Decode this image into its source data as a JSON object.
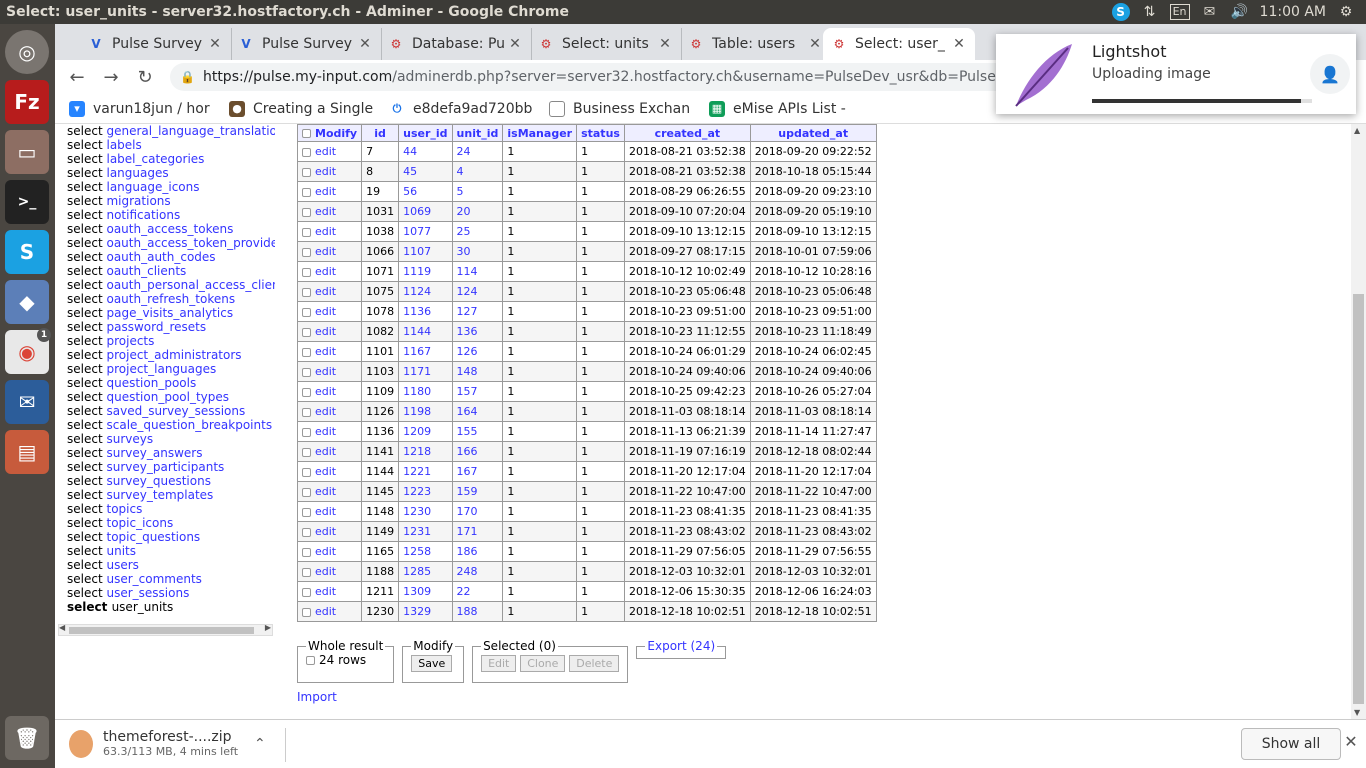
{
  "window_title": "Select: user_units - server32.hostfactory.ch - Adminer - Google Chrome",
  "tray": {
    "keyboard": "En",
    "time": "11:00 AM"
  },
  "launcher_badge": "1",
  "tabs": [
    {
      "label": "Pulse Survey",
      "icon": "pulse-icon"
    },
    {
      "label": "Pulse Survey",
      "icon": "pulse-icon"
    },
    {
      "label": "Database: Pu",
      "icon": "adminer-icon"
    },
    {
      "label": "Select: units",
      "icon": "adminer-icon"
    },
    {
      "label": "Table: users",
      "icon": "adminer-icon"
    },
    {
      "label": "Select: user_",
      "icon": "adminer-icon"
    }
  ],
  "address": {
    "host": "https://pulse.my-input.com",
    "rest": "/adminerdb.php?server=server32.hostfactory.ch&username=PulseDev_usr&db=PulseDev&select=us"
  },
  "bookmarks": [
    {
      "label": "varun18jun / hor",
      "icon": "bitbucket-icon"
    },
    {
      "label": "Creating a Single",
      "icon": "person-icon"
    },
    {
      "label": "e8defa9ad720bb",
      "icon": "power-icon"
    },
    {
      "label": "Business Exchan",
      "icon": "page-icon"
    },
    {
      "label": "eMise APIs List -",
      "icon": "sheets-icon"
    }
  ],
  "menu": {
    "prefix": "select",
    "items": [
      "general_language_translations",
      "labels",
      "label_categories",
      "languages",
      "language_icons",
      "migrations",
      "notifications",
      "oauth_access_tokens",
      "oauth_access_token_providers",
      "oauth_auth_codes",
      "oauth_clients",
      "oauth_personal_access_clients",
      "oauth_refresh_tokens",
      "page_visits_analytics",
      "password_resets",
      "projects",
      "project_administrators",
      "project_languages",
      "question_pools",
      "question_pool_types",
      "saved_survey_sessions",
      "scale_question_breakpoints",
      "surveys",
      "survey_answers",
      "survey_participants",
      "survey_questions",
      "survey_templates",
      "topics",
      "topic_icons",
      "topic_questions",
      "units",
      "users",
      "user_comments",
      "user_sessions"
    ],
    "current": "user_units"
  },
  "table": {
    "modify_label": "Modify",
    "edit_label": "edit",
    "columns": [
      "id",
      "user_id",
      "unit_id",
      "isManager",
      "status",
      "created_at",
      "updated_at"
    ],
    "rows": [
      [
        "7",
        "44",
        "24",
        "1",
        "1",
        "2018-08-21 03:52:38",
        "2018-09-20 09:22:52"
      ],
      [
        "8",
        "45",
        "4",
        "1",
        "1",
        "2018-08-21 03:52:38",
        "2018-10-18 05:15:44"
      ],
      [
        "19",
        "56",
        "5",
        "1",
        "1",
        "2018-08-29 06:26:55",
        "2018-09-20 09:23:10"
      ],
      [
        "1031",
        "1069",
        "20",
        "1",
        "1",
        "2018-09-10 07:20:04",
        "2018-09-20 05:19:10"
      ],
      [
        "1038",
        "1077",
        "25",
        "1",
        "1",
        "2018-09-10 13:12:15",
        "2018-09-10 13:12:15"
      ],
      [
        "1066",
        "1107",
        "30",
        "1",
        "1",
        "2018-09-27 08:17:15",
        "2018-10-01 07:59:06"
      ],
      [
        "1071",
        "1119",
        "114",
        "1",
        "1",
        "2018-10-12 10:02:49",
        "2018-10-12 10:28:16"
      ],
      [
        "1075",
        "1124",
        "124",
        "1",
        "1",
        "2018-10-23 05:06:48",
        "2018-10-23 05:06:48"
      ],
      [
        "1078",
        "1136",
        "127",
        "1",
        "1",
        "2018-10-23 09:51:00",
        "2018-10-23 09:51:00"
      ],
      [
        "1082",
        "1144",
        "136",
        "1",
        "1",
        "2018-10-23 11:12:55",
        "2018-10-23 11:18:49"
      ],
      [
        "1101",
        "1167",
        "126",
        "1",
        "1",
        "2018-10-24 06:01:29",
        "2018-10-24 06:02:45"
      ],
      [
        "1103",
        "1171",
        "148",
        "1",
        "1",
        "2018-10-24 09:40:06",
        "2018-10-24 09:40:06"
      ],
      [
        "1109",
        "1180",
        "157",
        "1",
        "1",
        "2018-10-25 09:42:23",
        "2018-10-26 05:27:04"
      ],
      [
        "1126",
        "1198",
        "164",
        "1",
        "1",
        "2018-11-03 08:18:14",
        "2018-11-03 08:18:14"
      ],
      [
        "1136",
        "1209",
        "155",
        "1",
        "1",
        "2018-11-13 06:21:39",
        "2018-11-14 11:27:47"
      ],
      [
        "1141",
        "1218",
        "166",
        "1",
        "1",
        "2018-11-19 07:16:19",
        "2018-12-18 08:02:44"
      ],
      [
        "1144",
        "1221",
        "167",
        "1",
        "1",
        "2018-11-20 12:17:04",
        "2018-11-20 12:17:04"
      ],
      [
        "1145",
        "1223",
        "159",
        "1",
        "1",
        "2018-11-22 10:47:00",
        "2018-11-22 10:47:00"
      ],
      [
        "1148",
        "1230",
        "170",
        "1",
        "1",
        "2018-11-23 08:41:35",
        "2018-11-23 08:41:35"
      ],
      [
        "1149",
        "1231",
        "171",
        "1",
        "1",
        "2018-11-23 08:43:02",
        "2018-11-23 08:43:02"
      ],
      [
        "1165",
        "1258",
        "186",
        "1",
        "1",
        "2018-11-29 07:56:05",
        "2018-11-29 07:56:55"
      ],
      [
        "1188",
        "1285",
        "248",
        "1",
        "1",
        "2018-12-03 10:32:01",
        "2018-12-03 10:32:01"
      ],
      [
        "1211",
        "1309",
        "22",
        "1",
        "1",
        "2018-12-06 15:30:35",
        "2018-12-06 16:24:03"
      ],
      [
        "1230",
        "1329",
        "188",
        "1",
        "1",
        "2018-12-18 10:02:51",
        "2018-12-18 10:02:51"
      ]
    ]
  },
  "controls": {
    "whole_result_legend": "Whole result",
    "rows_label": "24 rows",
    "modify_legend": "Modify",
    "save_label": "Save",
    "selected_legend": "Selected (0)",
    "edit_label": "Edit",
    "clone_label": "Clone",
    "delete_label": "Delete",
    "export_label": "Export (24)",
    "import_label": "Import"
  },
  "download": {
    "filename": "themeforest-....zip",
    "status": "63.3/113 MB, 4 mins left",
    "show_all": "Show all"
  },
  "lightshot": {
    "title": "Lightshot",
    "status": "Uploading image",
    "progress": 0.95
  },
  "colors": {
    "link": "#3434ff",
    "header_bg": "#eeeeff",
    "ubuntu_bar": "#3c3b37",
    "launcher": "#4a4641"
  }
}
